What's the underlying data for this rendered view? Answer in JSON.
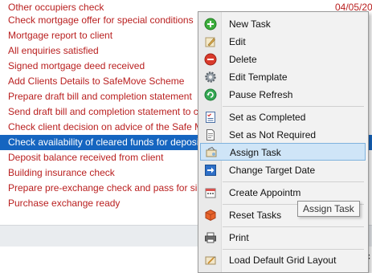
{
  "grid": {
    "rows": [
      {
        "text": "Other occupiers check",
        "date": "04/05/202"
      },
      {
        "text": "Check mortgage offer for special conditions",
        "date": ""
      },
      {
        "text": "Mortgage report to client",
        "date": ""
      },
      {
        "text": "All enquiries satisfied",
        "date": ""
      },
      {
        "text": "Signed mortgage deed received",
        "date": ""
      },
      {
        "text": "Add Clients Details to SafeMove Scheme",
        "date": ""
      },
      {
        "text": "Prepare draft bill and completion statement",
        "date": ""
      },
      {
        "text": "Send draft bill and completion statement to clie",
        "date": ""
      },
      {
        "text": "Check client decision on advice of the Safe Move",
        "date": ""
      },
      {
        "text": "Check availability of cleared funds for deposit",
        "date": "02"
      },
      {
        "text": "Deposit balance received from client",
        "date": ""
      },
      {
        "text": "Building insurance check",
        "date": ""
      },
      {
        "text": "Prepare pre-exchange check and pass for sign o",
        "date": ""
      },
      {
        "text": "Purchase exchange ready",
        "date": ""
      }
    ],
    "right_text": "ic"
  },
  "menu": {
    "items": [
      {
        "label": "New Task",
        "icon": "plus-circle-icon"
      },
      {
        "label": "Edit",
        "icon": "edit-icon"
      },
      {
        "label": "Delete",
        "icon": "minus-circle-icon"
      },
      {
        "label": "Edit Template",
        "icon": "gear-icon"
      },
      {
        "label": "Pause Refresh",
        "icon": "refresh-icon"
      },
      {
        "label": "Set as Completed",
        "icon": "checklist-icon"
      },
      {
        "label": "Set as Not Required",
        "icon": "document-icon"
      },
      {
        "label": "Assign Task",
        "icon": "assign-task-icon"
      },
      {
        "label": "Change Target Date",
        "icon": "arrow-right-icon"
      },
      {
        "label": "Create Appointm",
        "icon": "calendar-icon"
      },
      {
        "label": "Reset Tasks",
        "icon": "reset-cube-icon"
      },
      {
        "label": "Print",
        "icon": "printer-icon"
      },
      {
        "label": "Load Default Grid Layout",
        "icon": "grid-layout-icon"
      }
    ],
    "highlighted": "Assign Task"
  },
  "tooltip": {
    "text": "Assign Task"
  },
  "colors": {
    "task_text": "#b91f1f",
    "selection": "#1565c0",
    "menu_highlight": "#cfe5f7"
  }
}
